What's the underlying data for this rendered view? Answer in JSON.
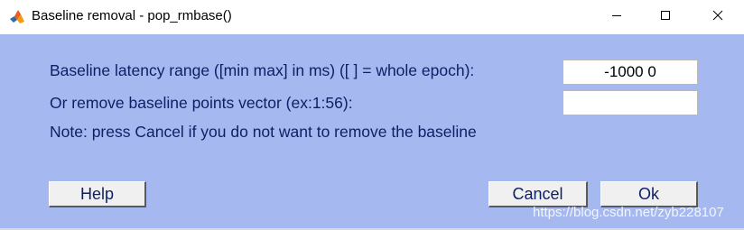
{
  "window": {
    "title": "Baseline removal - pop_rmbase()",
    "icon": "matlab-icon",
    "controls": [
      "minimize-icon",
      "maximize-icon",
      "close-icon"
    ]
  },
  "form": {
    "labels": {
      "latency": "Baseline latency range ([min max] in ms) ([ ] = whole epoch):",
      "points": "Or remove baseline points vector (ex:1:56):",
      "note": "Note: press Cancel if you do not want to remove the baseline"
    },
    "fields": {
      "latency_value": "-1000 0",
      "points_value": ""
    }
  },
  "buttons": {
    "help": "Help",
    "cancel": "Cancel",
    "ok": "Ok"
  },
  "watermark": "https://blog.csdn.net/zyb228107",
  "colors": {
    "background": "#a5b8f0",
    "text": "#0e1f66",
    "button": "#f0f0f0"
  }
}
